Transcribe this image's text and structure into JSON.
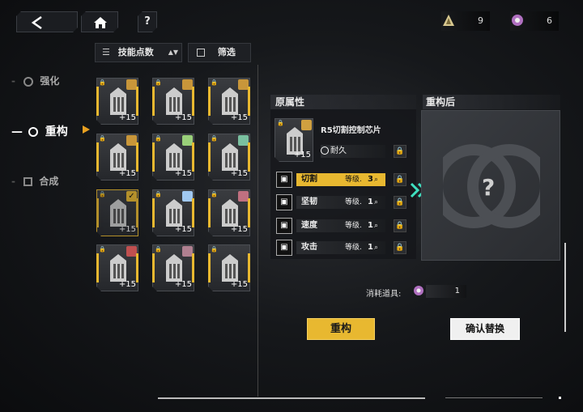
{
  "nav": {
    "back_icon": "back-arrow-icon",
    "home_icon": "home-icon",
    "help_label": "?"
  },
  "resources": [
    {
      "icon": "pyramid-icon",
      "value": "9"
    },
    {
      "icon": "gear-token-icon",
      "value": "6"
    }
  ],
  "sidebar": {
    "items": [
      {
        "label": "强化"
      },
      {
        "label": "重构"
      },
      {
        "label": "合成"
      }
    ]
  },
  "sort": {
    "label": "技能点数",
    "filter_label": "筛选"
  },
  "grid": {
    "level_label": "+15"
  },
  "origin": {
    "header": "原属性",
    "chip_name": "R5切割控制芯片",
    "chip_level": "+15",
    "durability": "耐久",
    "stats": [
      {
        "name": "切割",
        "level_label": "等级.",
        "level": "3"
      },
      {
        "name": "坚韧",
        "level_label": "等级.",
        "level": "1"
      },
      {
        "name": "速度",
        "level_label": "等级.",
        "level": "1"
      },
      {
        "name": "攻击",
        "level_label": "等级.",
        "level": "1"
      }
    ]
  },
  "result": {
    "header": "重构后",
    "unknown": "?"
  },
  "cost": {
    "label": "消耗道具:",
    "value": "1"
  },
  "actions": {
    "rebuild": "重构",
    "confirm": "确认替换"
  },
  "colors": {
    "accent": "#e8b830",
    "arrow": "#3fe0c0"
  }
}
